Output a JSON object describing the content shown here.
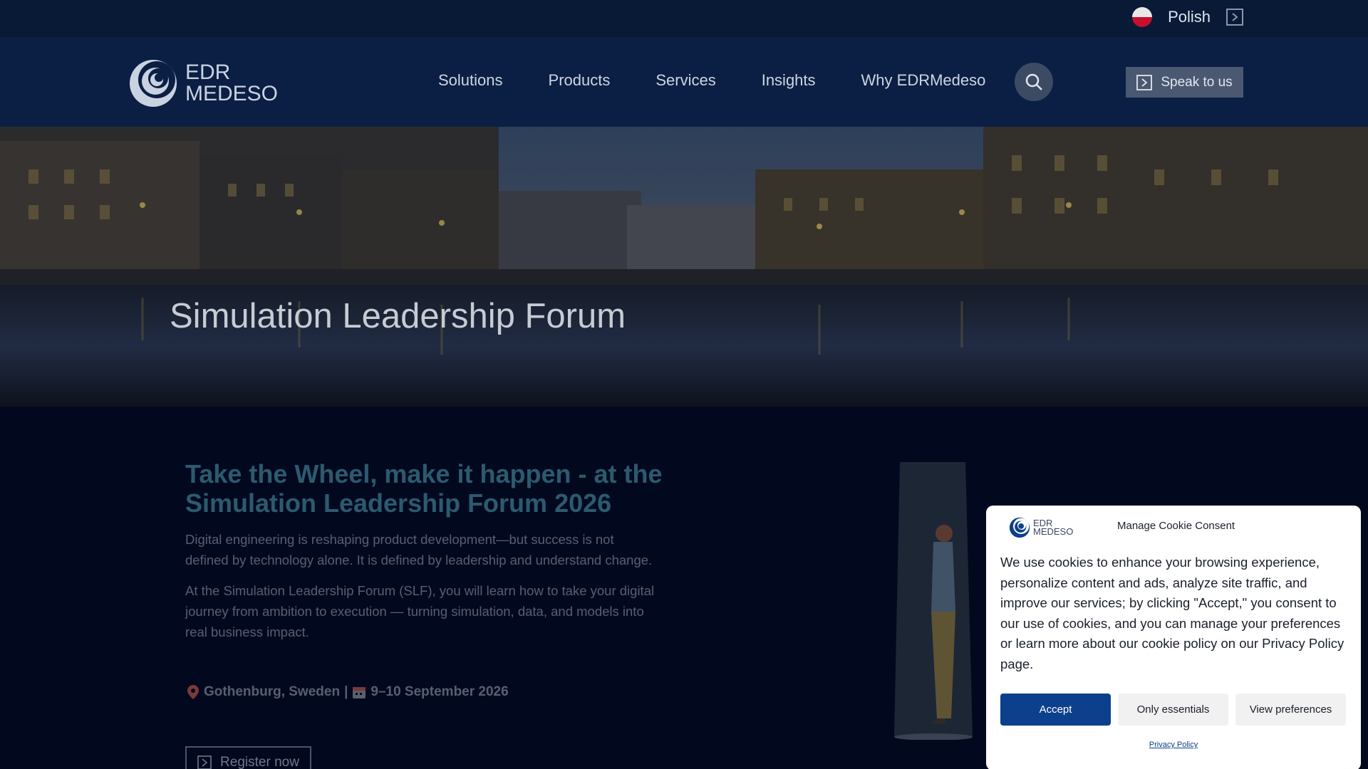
{
  "topbar": {
    "language": "Polish",
    "flag_colors": [
      "#ffffff",
      "#dc143c"
    ]
  },
  "header": {
    "logo_line1": "EDR",
    "logo_line2": "MEDESO",
    "nav": [
      "Solutions",
      "Products",
      "Services",
      "Insights",
      "Why EDRMedeso"
    ],
    "cta_label": "Speak to us"
  },
  "hero": {
    "title": "Simulation Leadership Forum"
  },
  "main": {
    "headline": "Take the Wheel, make it happen - at the Simulation Leadership Forum 2026",
    "paragraph1": "Digital engineering is reshaping product development—but success is not defined by technology alone. It is defined by leadership and understand change.",
    "paragraph2": "At the Simulation Leadership Forum (SLF), you will learn how to take your digital journey from ambition to execution — turning simulation, data, and models into real business impact.",
    "location": "Gothenburg, Sweden",
    "separator": "|",
    "dates": "9–10 September 2026",
    "register_label": "Register now"
  },
  "cookie": {
    "title": "Manage Cookie Consent",
    "logo_line1": "EDR",
    "logo_line2": "MEDESO",
    "body": "We use cookies to enhance your browsing experience, personalize content and ads, analyze site traffic, and improve our services; by clicking \"Accept,\" you consent to our use of cookies, and you can manage your preferences or learn more about our cookie policy on our Privacy Policy page.",
    "accept_label": "Accept",
    "essentials_label": "Only essentials",
    "preferences_label": "View preferences",
    "privacy_link": "Privacy Policy"
  },
  "colors": {
    "topbar_bg": "#091a37",
    "nav_bg": "#0b1f44",
    "accept_bg": "#0c3f8c",
    "headline": "#2c5a6e"
  }
}
